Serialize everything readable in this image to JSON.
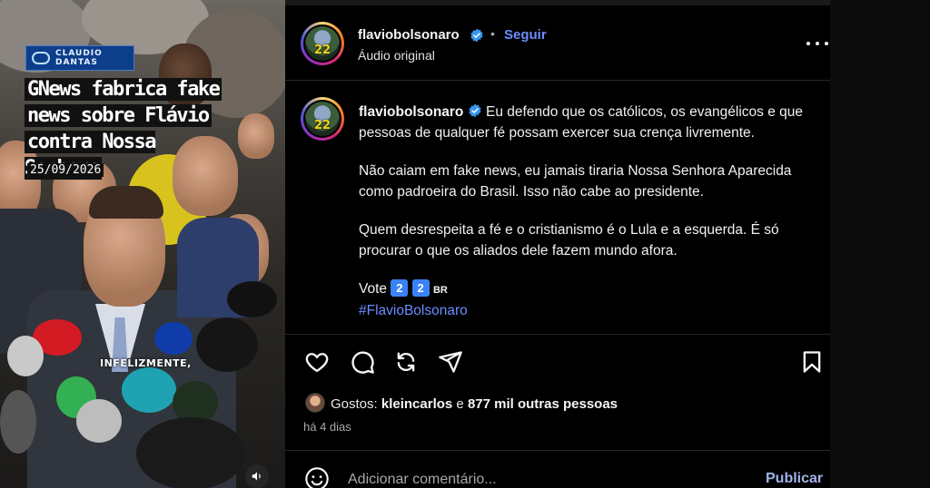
{
  "post": {
    "username": "flaviobolsonaro",
    "follow_label": "Seguir",
    "separator": "•",
    "audio_label": "Áudio original",
    "avatar_number": "22",
    "verified": true
  },
  "video": {
    "logo_text_line1": "CLAUDIO",
    "logo_text_line2": "DANTAS",
    "headline_lines": [
      "GNews fabrica fake",
      "news sobre Flávio",
      "contra Nossa Senhora"
    ],
    "date": "25/09/2026",
    "subtitle": "INFELIZMENTE,"
  },
  "caption": {
    "username": "flaviobolsonaro",
    "paragraph1": "Eu defendo que os católicos, os evangélicos e que pessoas de qualquer fé possam exercer sua crença livremente.",
    "paragraph2": "Não caiam em fake news, eu jamais tiraria Nossa Senhora Aparecida como padroeira do Brasil. Isso não cabe ao presidente.",
    "paragraph3": "Quem desrespeita a fé e o cristianismo é o Lula e a esquerda. É só procurar o que os aliados dele fazem mundo afora.",
    "vote_label": "Vote",
    "vote_digit1": "2",
    "vote_digit2": "2",
    "vote_suffix": "BR",
    "hashtag": "#FlavioBolsonaro"
  },
  "likes": {
    "prefix": "Gostos:",
    "user": "kleincarlos",
    "middle": "e",
    "others": "877 mil outras pessoas"
  },
  "time_ago": "há 4 dias",
  "comment": {
    "placeholder": "Adicionar comentário...",
    "publish_label": "Publicar"
  },
  "icons": {
    "like": "heart-icon",
    "comment": "comment-bubble-icon",
    "share_repost": "repost-icon",
    "send": "paper-plane-icon",
    "save": "bookmark-icon",
    "emoji": "smiley-icon",
    "more": "more-dots-icon",
    "sound": "speaker-icon"
  },
  "colors": {
    "link_blue": "#6b8cff",
    "background": "#000000",
    "verified_blue": "#3897f0"
  }
}
